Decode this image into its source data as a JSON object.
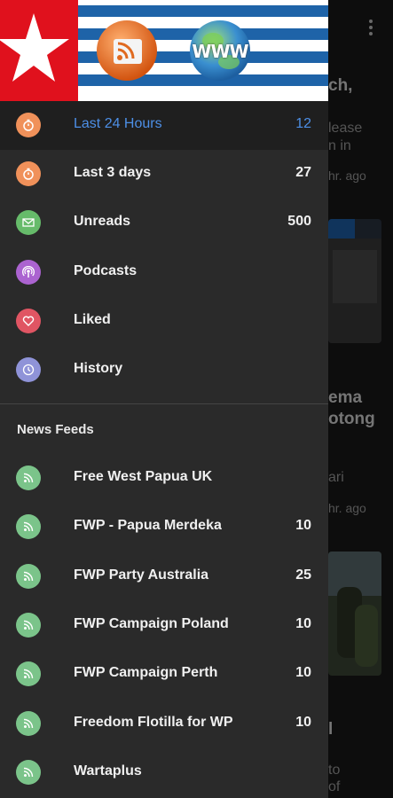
{
  "colors": {
    "accent": "#4d8fe6",
    "drawer_bg": "#2a2a2a",
    "orange": "#f0915a",
    "green": "#66bb6a",
    "purple": "#ab63d0",
    "red": "#e05563",
    "lavender": "#8f93d8",
    "feed_green": "#7bc48a"
  },
  "header": {
    "logo_left": "red-star-flag",
    "logo_mid": "rss-icon",
    "logo_right": "www-globe-icon",
    "globe_text": "WWW"
  },
  "filters": [
    {
      "label": "Last 24 Hours",
      "count": "12",
      "icon": "timer-icon"
    },
    {
      "label": "Last 3 days",
      "count": "27",
      "icon": "timer-icon"
    },
    {
      "label": "Unreads",
      "count": "500",
      "icon": "mail-icon"
    },
    {
      "label": "Podcasts",
      "count": "",
      "icon": "podcast-icon"
    },
    {
      "label": "Liked",
      "count": "",
      "icon": "heart-icon"
    },
    {
      "label": "History",
      "count": "",
      "icon": "history-icon"
    }
  ],
  "news_feeds": {
    "title": "News Feeds",
    "items": [
      {
        "label": "Free West Papua UK",
        "count": ""
      },
      {
        "label": "FWP - Papua Merdeka",
        "count": "10"
      },
      {
        "label": "FWP Party Australia",
        "count": "25"
      },
      {
        "label": "FWP Campaign Poland",
        "count": "10"
      },
      {
        "label": "FWP Campaign Perth",
        "count": "10"
      },
      {
        "label": "Freedom Flotilla for WP",
        "count": "10"
      },
      {
        "label": "Wartaplus",
        "count": ""
      }
    ]
  },
  "background": {
    "line1": "ch,",
    "line2": "lease",
    "line3": "n in",
    "line4": "hr. ago",
    "line5": "ema",
    "line6": "otong",
    "line7": "ari",
    "line8": "hr. ago",
    "line9": "l",
    "line10": "to",
    "line11": "of"
  }
}
